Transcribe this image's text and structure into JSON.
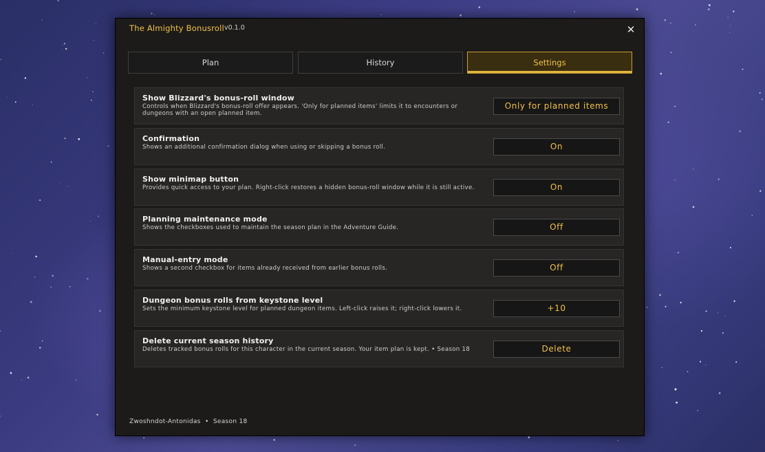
{
  "window": {
    "title": "The Almighty Bonusroll",
    "version": "v0.1.0",
    "close_glyph": "✕"
  },
  "tabs": [
    {
      "label": "Plan",
      "active": false
    },
    {
      "label": "History",
      "active": false
    },
    {
      "label": "Settings",
      "active": true
    }
  ],
  "settings": [
    {
      "title": "Show Blizzard's bonus-roll window",
      "description": "Controls when Blizzard's bonus-roll offer appears. 'Only for planned items' limits it to encounters or dungeons with an open planned item.",
      "value": "Only for planned items"
    },
    {
      "title": "Confirmation",
      "description": "Shows an additional confirmation dialog when using or skipping a bonus roll.",
      "value": "On"
    },
    {
      "title": "Show minimap button",
      "description": "Provides quick access to your plan. Right-click restores a hidden bonus-roll window while it is still active.",
      "value": "On"
    },
    {
      "title": "Planning maintenance mode",
      "description": "Shows the checkboxes used to maintain the season plan in the Adventure Guide.",
      "value": "Off"
    },
    {
      "title": "Manual-entry mode",
      "description": "Shows a second checkbox for items already received from earlier bonus rolls.",
      "value": "Off"
    },
    {
      "title": "Dungeon bonus rolls from keystone level",
      "description": "Sets the minimum keystone level for planned dungeon items. Left-click raises it; right-click lowers it.",
      "value": "+10"
    },
    {
      "title": "Delete current season history",
      "description": "Deletes tracked bonus rolls for this character in the current season. Your item plan is kept. • Season 18",
      "value": "Delete"
    }
  ],
  "footer": {
    "text": "Zwoshndot-Antonidas  •  Season 18"
  },
  "colors": {
    "accent": "#f2c14a",
    "window_bg": "#1c1b19",
    "row_bg": "#272624"
  }
}
